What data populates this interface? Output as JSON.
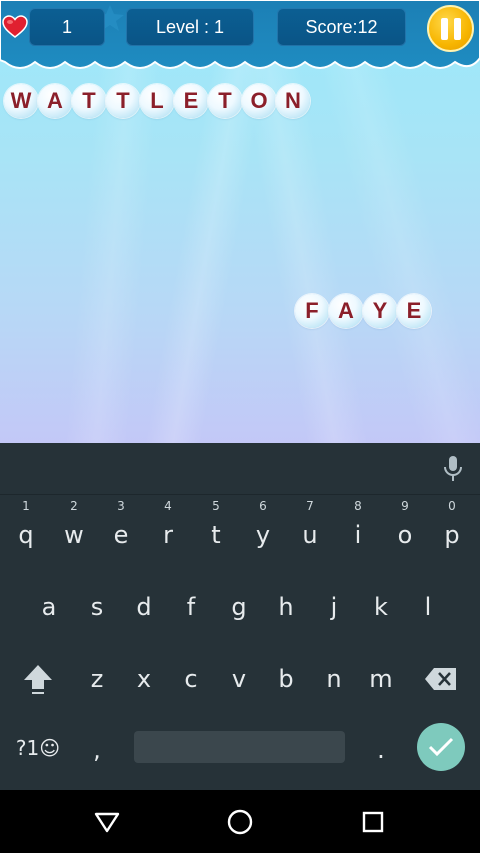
{
  "hud": {
    "lives": "1",
    "level": "Level : 1",
    "score": "Score:12"
  },
  "game_words": {
    "word1": [
      "W",
      "A",
      "T",
      "T",
      "L",
      "E",
      "T",
      "O",
      "N"
    ],
    "word2": [
      "F",
      "A",
      "Y",
      "E"
    ]
  },
  "keyboard": {
    "row1": [
      {
        "key": "q",
        "hint": "1"
      },
      {
        "key": "w",
        "hint": "2"
      },
      {
        "key": "e",
        "hint": "3"
      },
      {
        "key": "r",
        "hint": "4"
      },
      {
        "key": "t",
        "hint": "5"
      },
      {
        "key": "y",
        "hint": "6"
      },
      {
        "key": "u",
        "hint": "7"
      },
      {
        "key": "i",
        "hint": "8"
      },
      {
        "key": "o",
        "hint": "9"
      },
      {
        "key": "p",
        "hint": "0"
      }
    ],
    "row2": [
      "a",
      "s",
      "d",
      "f",
      "g",
      "h",
      "j",
      "k",
      "l"
    ],
    "row3": [
      "z",
      "x",
      "c",
      "v",
      "b",
      "n",
      "m"
    ],
    "symbols_label": "?1☺",
    "comma": ",",
    "period": "."
  },
  "icons": {
    "heart": "heart-icon",
    "pause": "pause-icon",
    "mic": "microphone-icon",
    "shift": "shift-icon",
    "backspace": "backspace-icon",
    "enter": "check-icon",
    "back": "back-triangle-icon",
    "home": "home-circle-icon",
    "recents": "recents-square-icon"
  },
  "colors": {
    "letter": "#8b1f2a",
    "hud_panel": "#0b5f93",
    "pause_button": "#f7b500",
    "keyboard_bg": "#263238",
    "enter_key": "#7ecabd"
  }
}
